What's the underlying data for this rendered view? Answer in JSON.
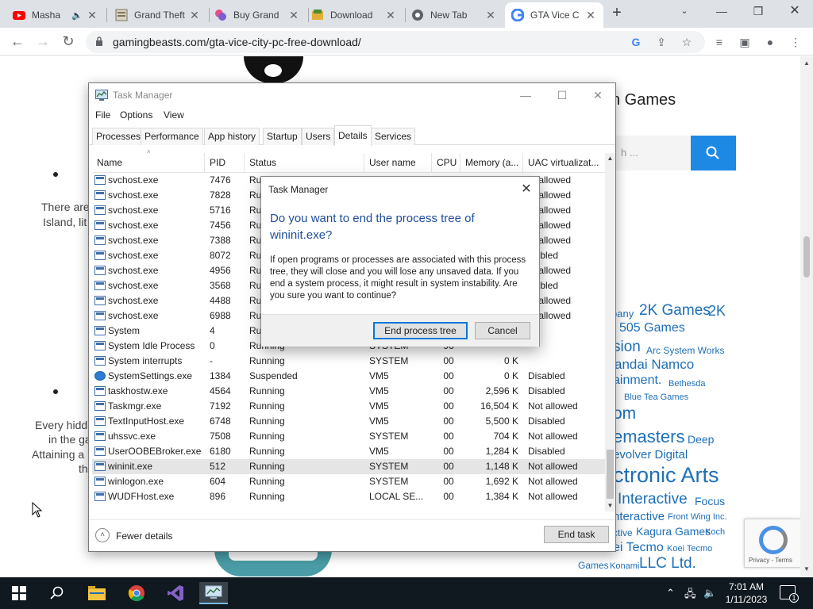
{
  "browser": {
    "tabs": [
      {
        "title": "Masha",
        "icon": "youtube-icon",
        "audio": true
      },
      {
        "title": "Grand Theft",
        "icon": "page-icon"
      },
      {
        "title": "Buy Grand",
        "icon": "buy-icon"
      },
      {
        "title": "Download",
        "icon": "download-site-icon"
      },
      {
        "title": "New Tab",
        "icon": "chrome-icon"
      },
      {
        "title": "GTA Vice C",
        "icon": "google-icon",
        "active": true
      }
    ],
    "url": "gamingbeasts.com/gta-vice-city-pc-free-download/"
  },
  "page": {
    "heading_fragment": "h Games",
    "search_placeholder": "h ...",
    "text_lines": [
      "There are",
      "Island, lit",
      "Every hidd",
      "in the ga",
      "Attaining a",
      "th"
    ],
    "tags": [
      "pany",
      "2K Games",
      "2K",
      "505 Games",
      "sion",
      "Arc System Works",
      "andai Namco",
      "ainment.",
      "Bethesda",
      "Blue Tea Games",
      "om",
      "emasters",
      "Deep",
      "evolver Digital",
      "ctronic Arts",
      "Interactive",
      "Focus",
      "nteractive",
      "Front Wing Inc.",
      "ctive",
      "Kagura Games",
      "Koch",
      "ei Tecmo",
      "Koei Tecmo",
      "Games",
      "Konami",
      "LLC Ltd."
    ],
    "recaptcha_links": "Privacy - Terms"
  },
  "taskmanager": {
    "title": "Task Manager",
    "menu": [
      "File",
      "Options",
      "View"
    ],
    "tabs": [
      "Processes",
      "Performance",
      "App history",
      "Startup",
      "Users",
      "Details",
      "Services"
    ],
    "active_tab": "Details",
    "columns": [
      "Name",
      "PID",
      "Status",
      "User name",
      "CPU",
      "Memory (a...",
      "UAC virtualizat..."
    ],
    "rows": [
      {
        "name": "svchost.exe",
        "pid": "7476",
        "status": "Ru",
        "user": "",
        "cpu": "",
        "mem": "",
        "uac": "ot allowed"
      },
      {
        "name": "svchost.exe",
        "pid": "7828",
        "status": "Ru",
        "user": "",
        "cpu": "",
        "mem": "",
        "uac": "ot allowed"
      },
      {
        "name": "svchost.exe",
        "pid": "5716",
        "status": "Ru",
        "user": "",
        "cpu": "",
        "mem": "",
        "uac": "ot allowed"
      },
      {
        "name": "svchost.exe",
        "pid": "7456",
        "status": "Ru",
        "user": "",
        "cpu": "",
        "mem": "",
        "uac": "ot allowed"
      },
      {
        "name": "svchost.exe",
        "pid": "7388",
        "status": "Ru",
        "user": "",
        "cpu": "",
        "mem": "",
        "uac": "ot allowed"
      },
      {
        "name": "svchost.exe",
        "pid": "8072",
        "status": "Ru",
        "user": "",
        "cpu": "",
        "mem": "",
        "uac": "isabled"
      },
      {
        "name": "svchost.exe",
        "pid": "4956",
        "status": "Ru",
        "user": "",
        "cpu": "",
        "mem": "",
        "uac": "ot allowed"
      },
      {
        "name": "svchost.exe",
        "pid": "3568",
        "status": "Ru",
        "user": "",
        "cpu": "",
        "mem": "",
        "uac": "isabled"
      },
      {
        "name": "svchost.exe",
        "pid": "4488",
        "status": "Ru",
        "user": "",
        "cpu": "",
        "mem": "",
        "uac": "ot allowed"
      },
      {
        "name": "svchost.exe",
        "pid": "6988",
        "status": "Ru",
        "user": "",
        "cpu": "",
        "mem": "",
        "uac": "ot allowed"
      },
      {
        "name": "System",
        "pid": "4",
        "status": "Ru",
        "user": "",
        "cpu": "",
        "mem": "",
        "uac": ""
      },
      {
        "name": "System Idle Process",
        "pid": "0",
        "status": "Running",
        "user": "SYSTEM",
        "cpu": "96",
        "mem": "",
        "uac": ""
      },
      {
        "name": "System interrupts",
        "pid": "-",
        "status": "Running",
        "user": "SYSTEM",
        "cpu": "00",
        "mem": "0 K",
        "uac": ""
      },
      {
        "name": "SystemSettings.exe",
        "pid": "1384",
        "status": "Suspended",
        "user": "VM5",
        "cpu": "00",
        "mem": "0 K",
        "uac": "Disabled",
        "gear": true
      },
      {
        "name": "taskhostw.exe",
        "pid": "4564",
        "status": "Running",
        "user": "VM5",
        "cpu": "00",
        "mem": "2,596 K",
        "uac": "Disabled"
      },
      {
        "name": "Taskmgr.exe",
        "pid": "7192",
        "status": "Running",
        "user": "VM5",
        "cpu": "00",
        "mem": "16,504 K",
        "uac": "Not allowed"
      },
      {
        "name": "TextInputHost.exe",
        "pid": "6748",
        "status": "Running",
        "user": "VM5",
        "cpu": "00",
        "mem": "5,500 K",
        "uac": "Disabled"
      },
      {
        "name": "uhssvc.exe",
        "pid": "7508",
        "status": "Running",
        "user": "SYSTEM",
        "cpu": "00",
        "mem": "704 K",
        "uac": "Not allowed"
      },
      {
        "name": "UserOOBEBroker.exe",
        "pid": "6180",
        "status": "Running",
        "user": "VM5",
        "cpu": "00",
        "mem": "1,284 K",
        "uac": "Disabled"
      },
      {
        "name": "wininit.exe",
        "pid": "512",
        "status": "Running",
        "user": "SYSTEM",
        "cpu": "00",
        "mem": "1,148 K",
        "uac": "Not allowed",
        "selected": true
      },
      {
        "name": "winlogon.exe",
        "pid": "604",
        "status": "Running",
        "user": "SYSTEM",
        "cpu": "00",
        "mem": "1,692 K",
        "uac": "Not allowed"
      },
      {
        "name": "WUDFHost.exe",
        "pid": "896",
        "status": "Running",
        "user": "LOCAL SE...",
        "cpu": "00",
        "mem": "1,384 K",
        "uac": "Not allowed"
      }
    ],
    "fewer_details": "Fewer details",
    "end_task": "End task"
  },
  "dialog": {
    "title": "Task Manager",
    "heading": "Do you want to end the process tree of wininit.exe?",
    "body": "If open programs or processes are associated with this process tree, they will close and you will lose any unsaved data. If you end a system process, it might result in system instability. Are you sure you want to continue?",
    "primary_button": "End process tree",
    "cancel_button": "Cancel"
  },
  "taskbar": {
    "time": "7:01 AM",
    "date": "1/11/2023",
    "notification_count": "1",
    "pinned": [
      "start-icon",
      "search-icon",
      "file-explorer-icon",
      "chrome-icon",
      "visual-studio-icon",
      "task-manager-icon"
    ]
  },
  "colors": {
    "accent": "#0078d7",
    "dialog_heading": "#1f4e9a",
    "search_button": "#1e88e5",
    "taskbar": "#101820"
  }
}
